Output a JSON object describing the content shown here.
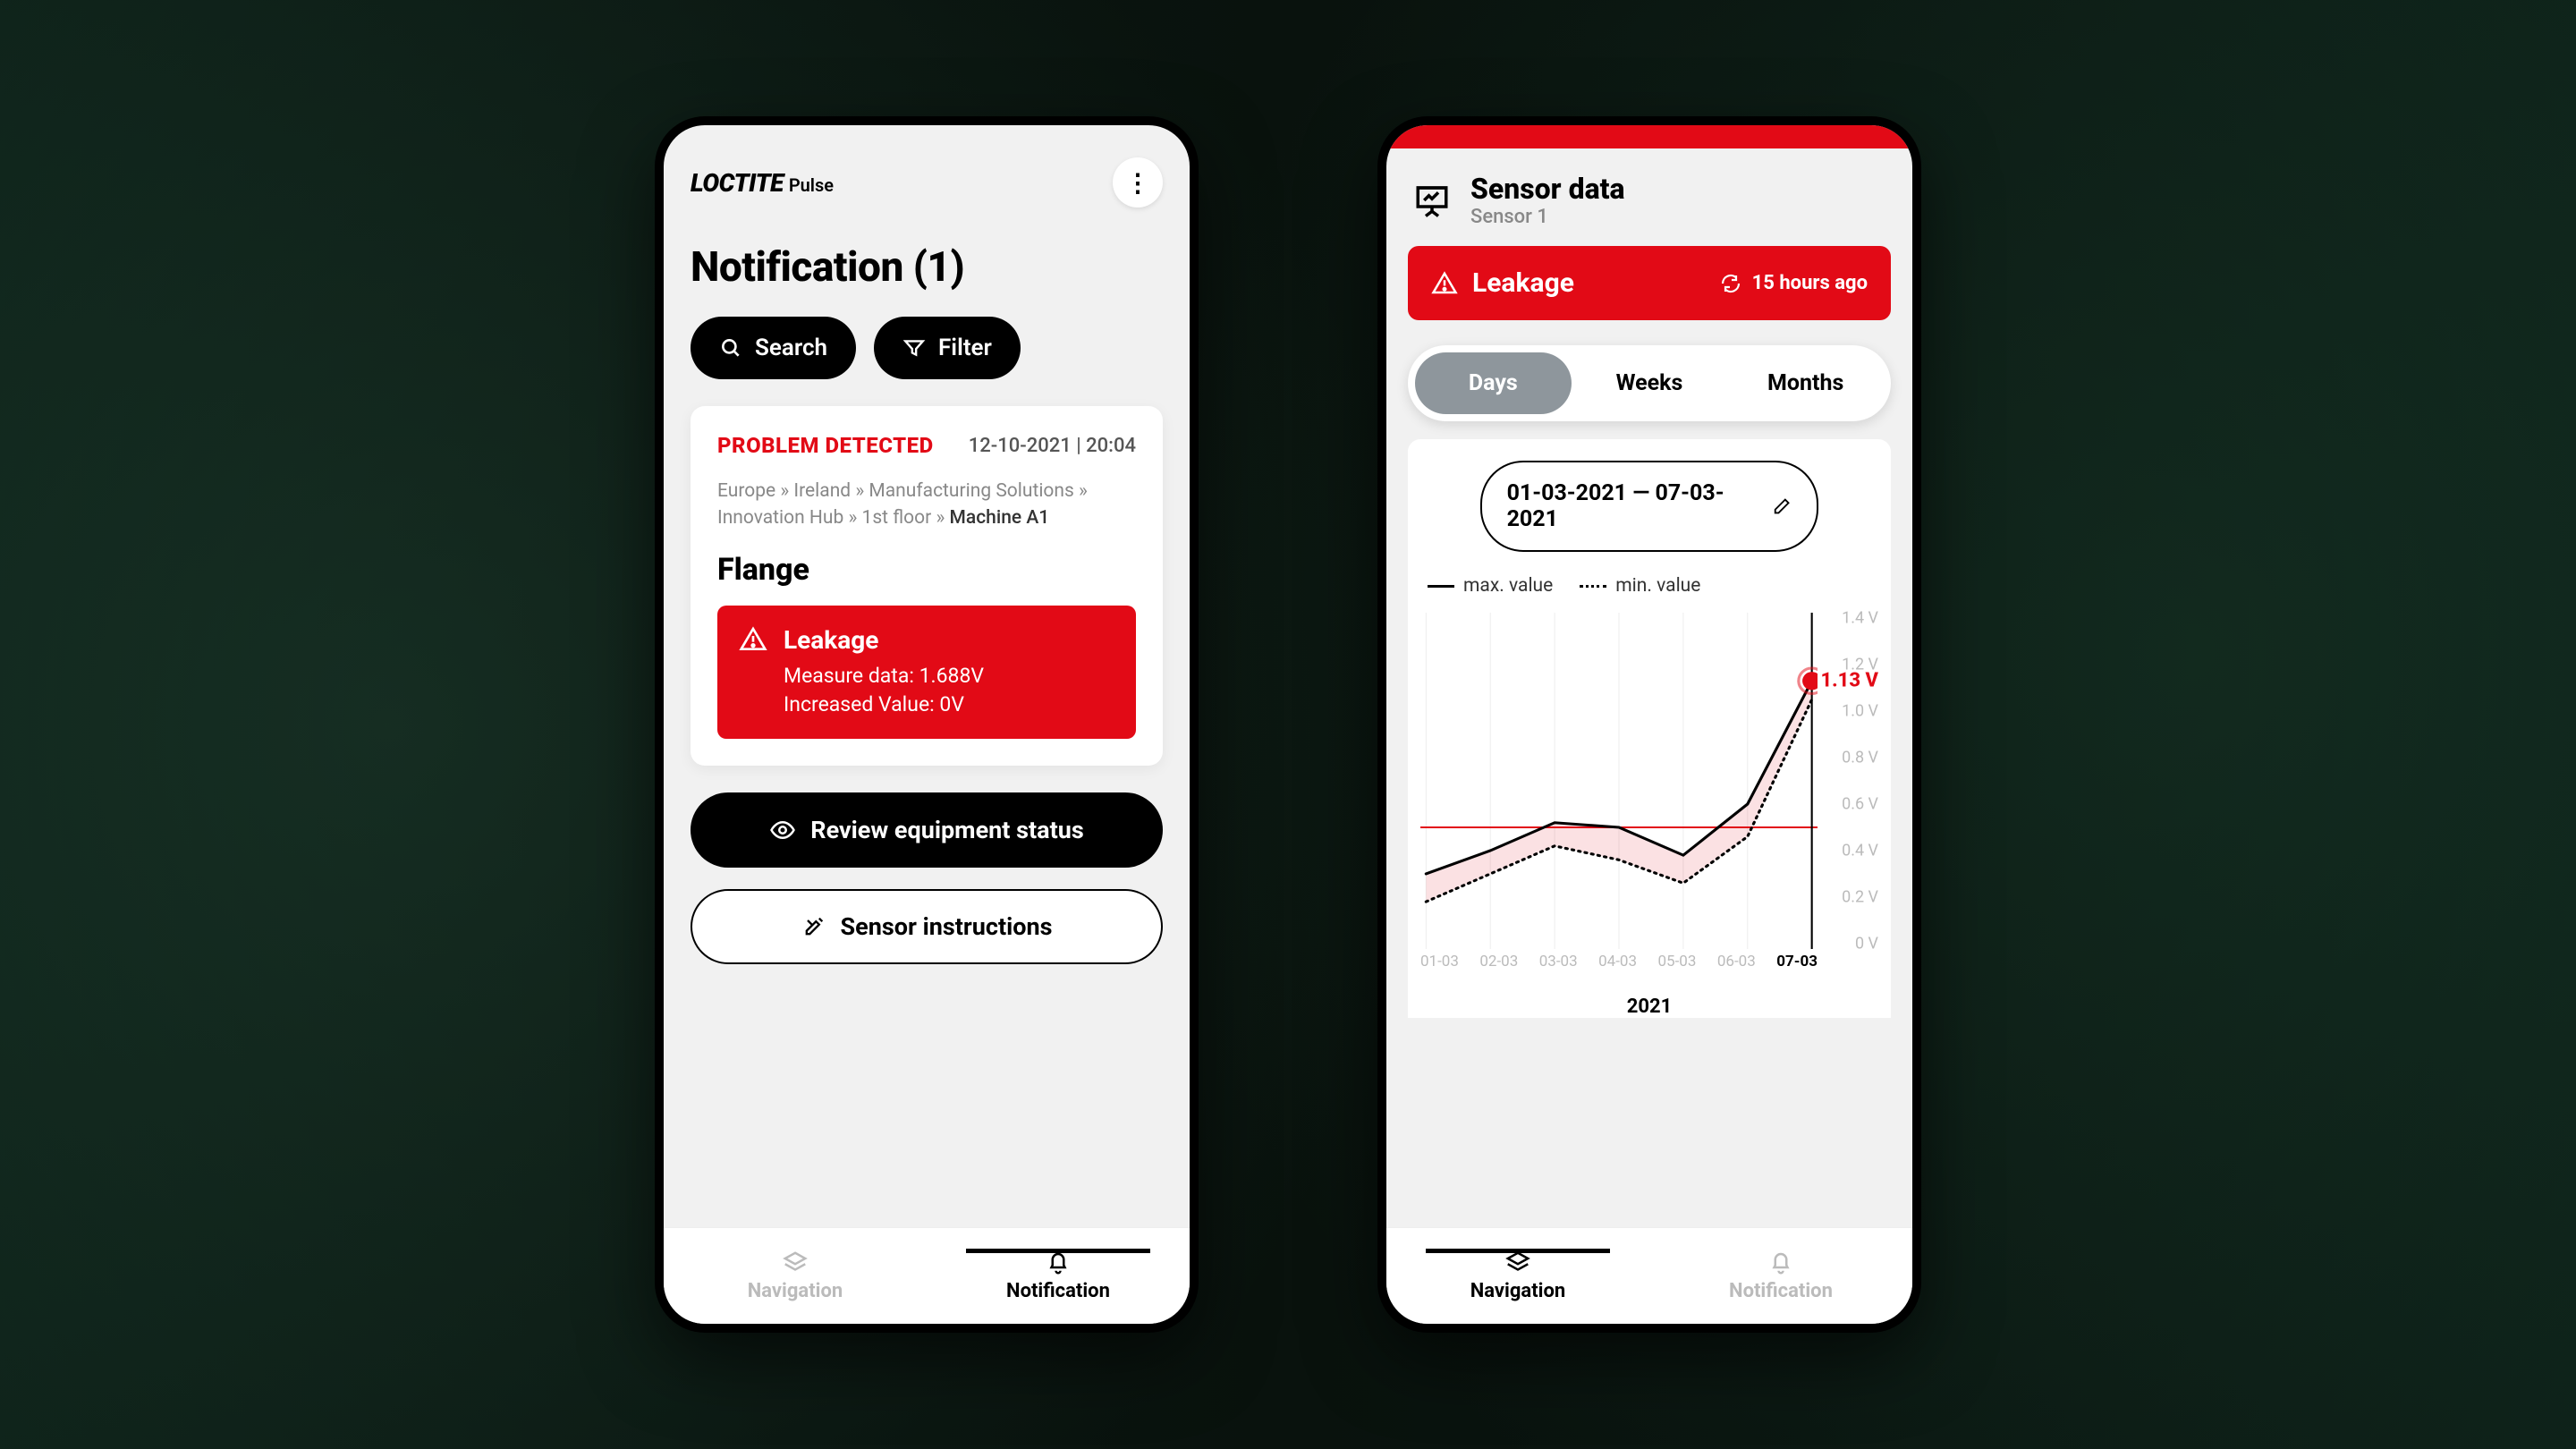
{
  "left": {
    "brand": {
      "logo": "LOCTITE",
      "sub": "Pulse"
    },
    "title": "Notification (1)",
    "actions": {
      "search": "Search",
      "filter": "Filter"
    },
    "card": {
      "problem": "PROBLEM DETECTED",
      "timestamp": "12-10-2021 | 20:04",
      "breadcrumb": "Europe » Ireland » Manufacturing Solutions » Innovation Hub » 1st floor » ",
      "breadcrumb_current": "Machine A1",
      "component": "Flange",
      "alert": {
        "title": "Leakage",
        "line1": "Measure data: 1.688V",
        "line2": "Increased Value: 0V"
      }
    },
    "buttons": {
      "review": "Review equipment status",
      "instructions": "Sensor instructions"
    },
    "tabs": {
      "nav": "Navigation",
      "notif": "Notification"
    }
  },
  "right": {
    "header": {
      "title": "Sensor data",
      "subtitle": "Sensor 1"
    },
    "banner": {
      "label": "Leakage",
      "ago": "15 hours ago"
    },
    "segments": {
      "days": "Days",
      "weeks": "Weeks",
      "months": "Months"
    },
    "date_range": "01-03-2021 — 07-03-2021",
    "legend": {
      "max": "max. value",
      "min": "min. value"
    },
    "year": "2021",
    "tabs": {
      "nav": "Navigation",
      "notif": "Notification"
    },
    "callout": "1.13 V"
  },
  "chart_data": {
    "type": "line",
    "title": "Sensor data — Sensor 1",
    "xlabel": "2021",
    "ylabel": "V",
    "ylim": [
      0,
      1.4
    ],
    "y_ticks": [
      0,
      0.2,
      0.4,
      0.6,
      0.8,
      1.0,
      1.2,
      1.4
    ],
    "categories": [
      "01-03",
      "02-03",
      "03-03",
      "04-03",
      "05-03",
      "06-03",
      "07-03"
    ],
    "series": [
      {
        "name": "max. value",
        "style": "solid",
        "values": [
          0.3,
          0.4,
          0.52,
          0.5,
          0.38,
          0.6,
          1.13
        ]
      },
      {
        "name": "min. value",
        "style": "dotted",
        "values": [
          0.18,
          0.3,
          0.42,
          0.36,
          0.26,
          0.46,
          1.05
        ]
      }
    ],
    "threshold": 0.5,
    "highlight": {
      "x": "07-03",
      "value": 1.13,
      "label": "1.13 V"
    }
  }
}
